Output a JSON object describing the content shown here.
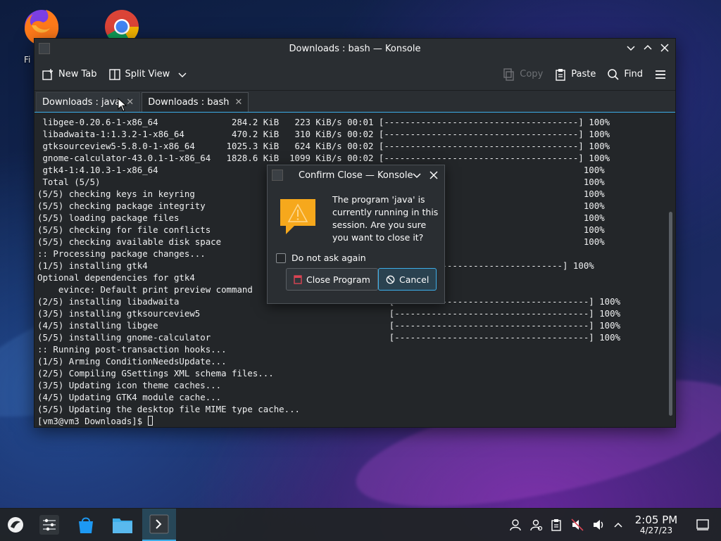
{
  "desktop": {
    "icons": [
      {
        "label": "Fi"
      }
    ]
  },
  "window": {
    "title": "Downloads : bash — Konsole",
    "toolbar": {
      "new_tab": "New Tab",
      "split_view": "Split View",
      "copy": "Copy",
      "paste": "Paste",
      "find": "Find"
    },
    "tabs": [
      {
        "label": "Downloads : java"
      },
      {
        "label": "Downloads : bash"
      }
    ],
    "terminal_lines": [
      " libgee-0.20.6-1-x86_64              284.2 KiB   223 KiB/s 00:01 [-------------------------------------] 100%",
      " libadwaita-1:1.3.2-1-x86_64         470.2 KiB   310 KiB/s 00:02 [-------------------------------------] 100%",
      " gtksourceview5-5.8.0-1-x86_64      1025.3 KiB   624 KiB/s 00:02 [-------------------------------------] 100%",
      " gnome-calculator-43.0.1-1-x86_64   1828.6 KiB  1099 KiB/s 00:02 [-------------------------------------] 100%",
      " gtk4-1:4.10.3-1-x86_64                                                                                 100%",
      " Total (5/5)                                                                                            100%",
      "(5/5) checking keys in keyring                                                                          100%",
      "(5/5) checking package integrity                                                                        100%",
      "(5/5) loading package files                                                                             100%",
      "(5/5) checking for file conflicts                                                                       100%",
      "(5/5) checking available disk space                                                                     100%",
      ":: Processing package changes...",
      "(1/5) installing gtk4                                                  -----------------------------] 100%",
      "Optional dependencies for gtk4",
      "    evince: Default print preview command",
      "(2/5) installing libadwaita                                        [-------------------------------------] 100%",
      "(3/5) installing gtksourceview5                                    [-------------------------------------] 100%",
      "(4/5) installing libgee                                            [-------------------------------------] 100%",
      "(5/5) installing gnome-calculator                                  [-------------------------------------] 100%",
      ":: Running post-transaction hooks...",
      "(1/5) Arming ConditionNeedsUpdate...",
      "(2/5) Compiling GSettings XML schema files...",
      "(3/5) Updating icon theme caches...",
      "(4/5) Updating GTK4 module cache...",
      "(5/5) Updating the desktop file MIME type cache...",
      "[vm3@vm3 Downloads]$ "
    ]
  },
  "dialog": {
    "title": "Confirm Close — Konsole",
    "message": "The program 'java' is currently running in this session.  Are you sure you want to close it?",
    "checkbox_label": "Do not ask again",
    "close_program": "Close Program",
    "cancel": "Cancel"
  },
  "taskbar": {
    "time": "2:05 PM",
    "date": "4/27/23"
  },
  "colors": {
    "accent": "#3daee9",
    "warning": "#f6a81c",
    "terminal_bg": "#232629"
  }
}
